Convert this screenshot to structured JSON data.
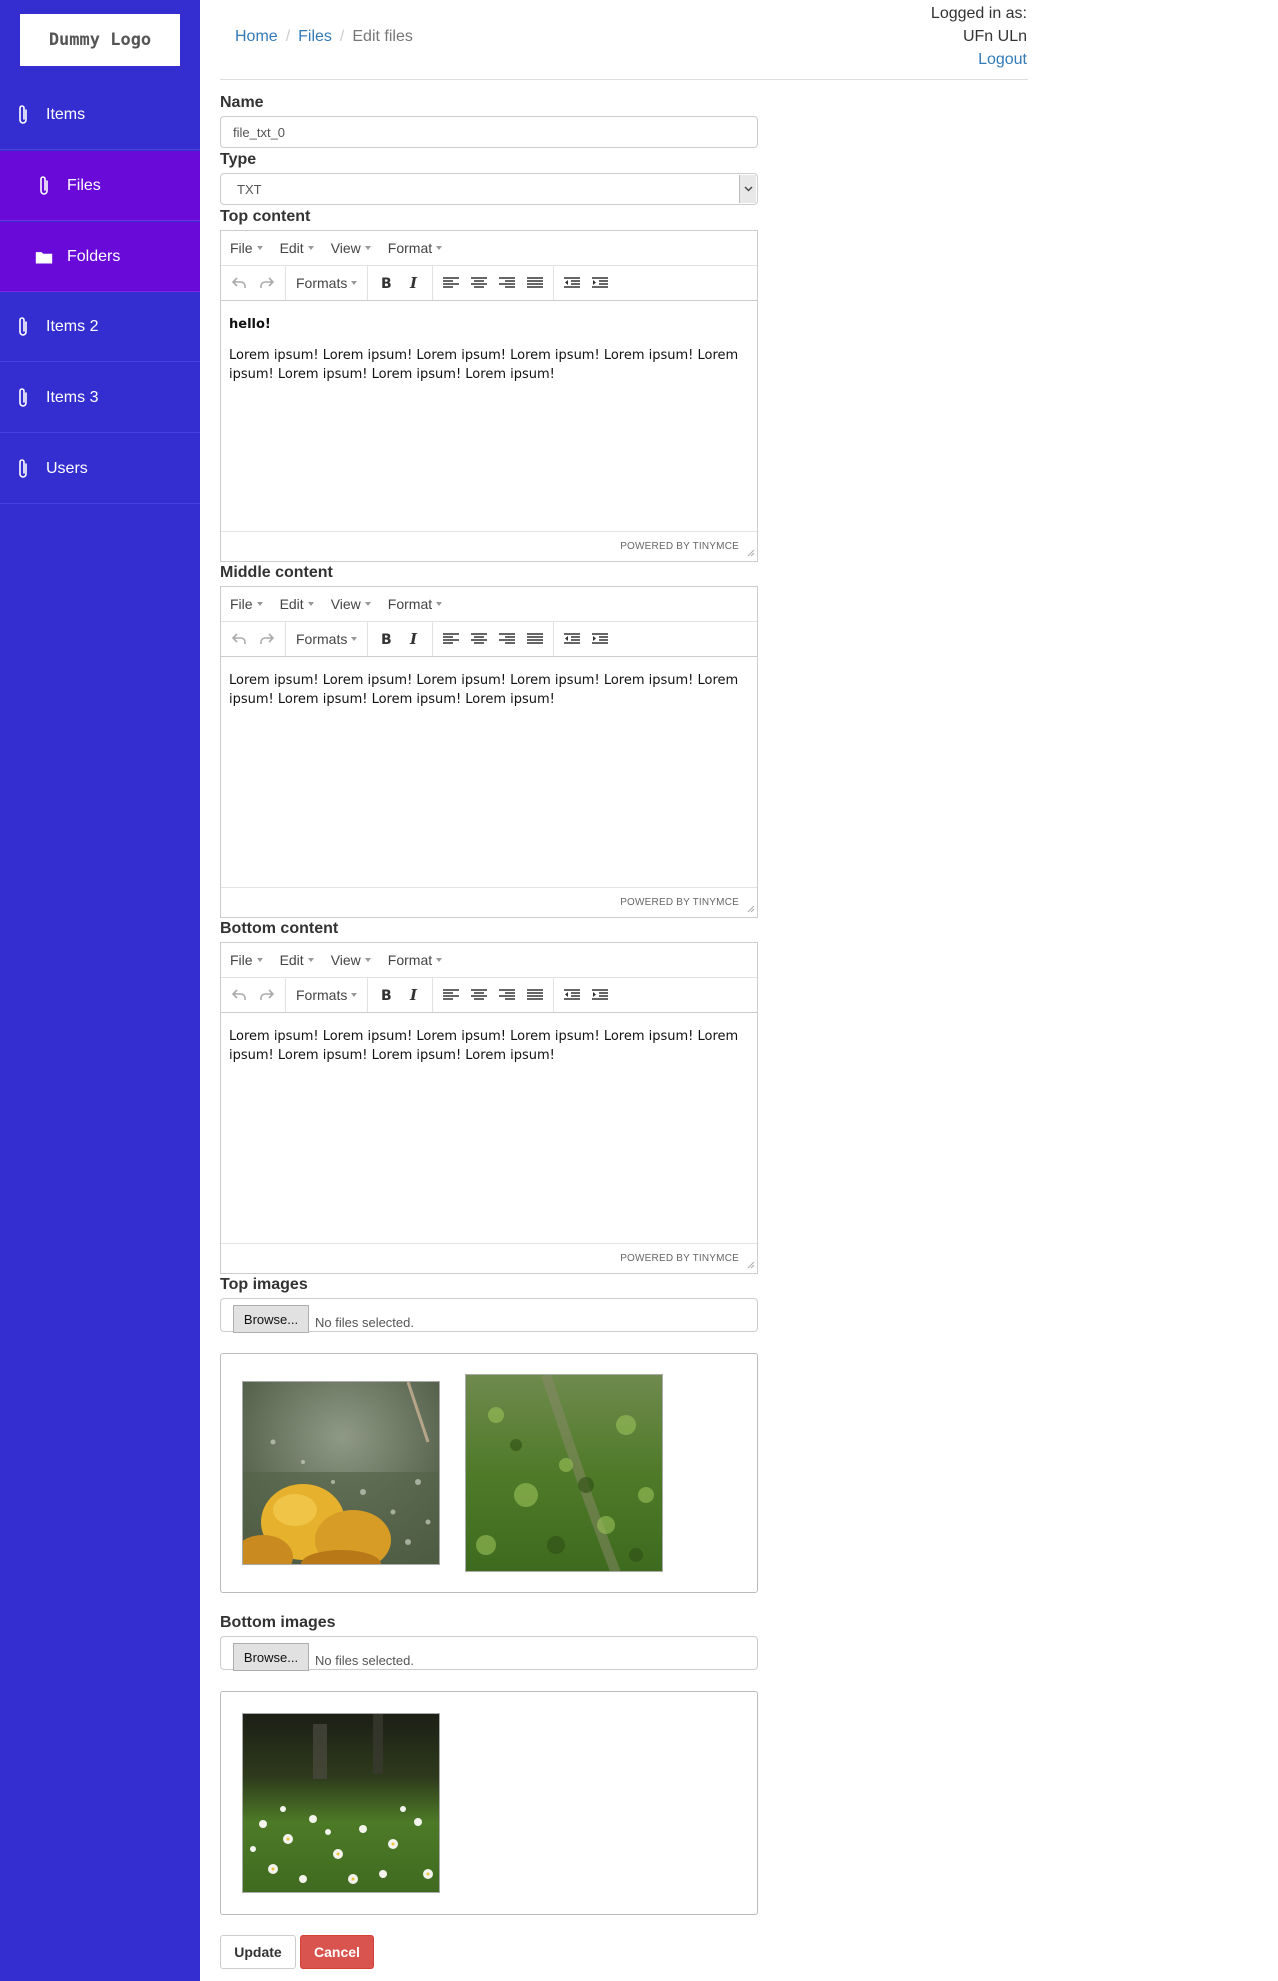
{
  "logo": {
    "text": "Dummy Logo"
  },
  "sidebar": {
    "items": [
      {
        "label": "Items",
        "icon": "paperclip-icon"
      },
      {
        "label": "Files",
        "icon": "paperclip-icon"
      },
      {
        "label": "Folders",
        "icon": "folder-icon"
      },
      {
        "label": "Items 2",
        "icon": "paperclip-icon"
      },
      {
        "label": "Items 3",
        "icon": "paperclip-icon"
      },
      {
        "label": "Users",
        "icon": "paperclip-icon"
      }
    ]
  },
  "breadcrumb": {
    "home": "Home",
    "files": "Files",
    "current": "Edit files",
    "separator": "/"
  },
  "user": {
    "logged_in_label": "Logged in as:",
    "name": "UFn ULn",
    "logout": "Logout"
  },
  "form": {
    "name_label": "Name",
    "name_value": "file_txt_0",
    "type_label": "Type",
    "type_value": "TXT",
    "top_content_label": "Top content",
    "middle_content_label": "Middle content",
    "bottom_content_label": "Bottom content",
    "top_images_label": "Top images",
    "bottom_images_label": "Bottom images"
  },
  "editor": {
    "menu": {
      "file": "File",
      "edit": "Edit",
      "view": "View",
      "format": "Format"
    },
    "formats": "Formats",
    "powered_by": "POWERED BY TINYMCE"
  },
  "contents": {
    "top": {
      "heading": "hello!",
      "text": "Lorem ipsum! Lorem ipsum! Lorem ipsum! Lorem ipsum! Lorem ipsum! Lorem ipsum! Lorem ipsum! Lorem ipsum! Lorem ipsum!"
    },
    "middle": {
      "text": "Lorem ipsum! Lorem ipsum! Lorem ipsum! Lorem ipsum! Lorem ipsum! Lorem ipsum! Lorem ipsum! Lorem ipsum! Lorem ipsum!"
    },
    "bottom": {
      "text": "Lorem ipsum! Lorem ipsum! Lorem ipsum! Lorem ipsum! Lorem ipsum! Lorem ipsum! Lorem ipsum! Lorem ipsum! Lorem ipsum!"
    }
  },
  "file_input": {
    "browse": "Browse...",
    "no_files": "No files selected."
  },
  "buttons": {
    "update": "Update",
    "cancel": "Cancel"
  },
  "colors": {
    "sidebar": "#342dcf",
    "sidebar_active": "#6a0ad9",
    "link": "#337ab7",
    "danger": "#d9534f"
  }
}
